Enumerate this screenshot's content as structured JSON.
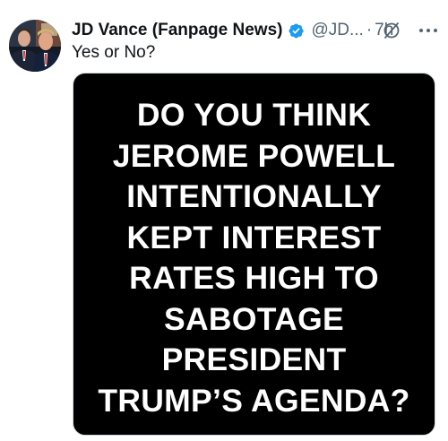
{
  "tweet": {
    "display_name": "JD Vance (Fanpage News)",
    "handle": "@JD...",
    "separator": "·",
    "timestamp": "7h",
    "text": "Yes or No?",
    "media_lines": [
      "DO YOU THINK",
      "JEROME POWELL",
      "INTENTIONALLY",
      "KEPT INTEREST",
      "RATES HIGH TO",
      "SABOTAGE",
      "PRESIDENT",
      "TRUMP’S AGENDA?"
    ]
  },
  "icons": {
    "verified": "verified-badge-icon",
    "grok": "grok-icon",
    "more": "more-options-icon"
  },
  "colors": {
    "accent": "#1d9bf0",
    "text_primary": "#0f1419",
    "text_secondary": "#536471",
    "media_background": "#000000",
    "media_text": "#ffffff"
  }
}
